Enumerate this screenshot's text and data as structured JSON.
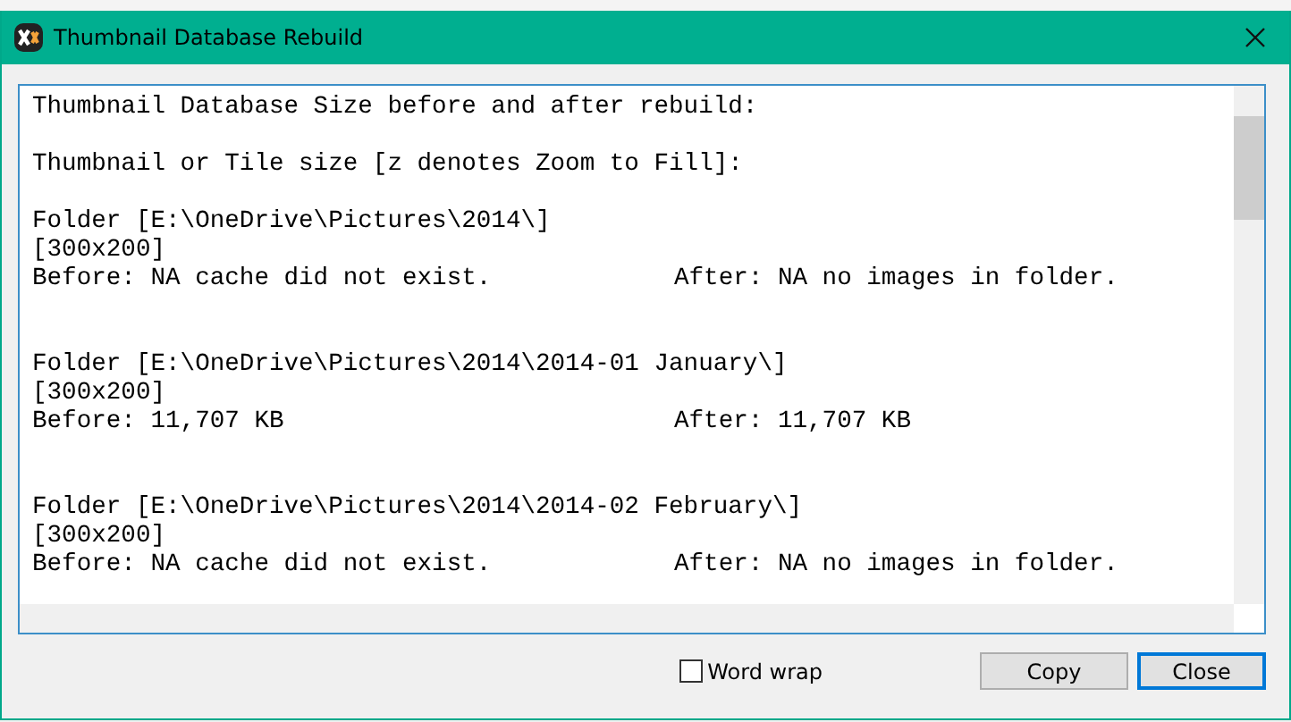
{
  "window": {
    "title": "Thumbnail Database Rebuild"
  },
  "log": {
    "lines": [
      {
        "kind": "text",
        "text": "Thumbnail Database Size before and after rebuild:"
      },
      {
        "kind": "blank"
      },
      {
        "kind": "text",
        "text": "Thumbnail or Tile size [z denotes Zoom to Fill]:"
      },
      {
        "kind": "blank"
      },
      {
        "kind": "text",
        "text": "Folder [E:\\OneDrive\\Pictures\\2014\\]"
      },
      {
        "kind": "text",
        "text": "[300x200]"
      },
      {
        "kind": "pair",
        "before": "Before: NA cache did not exist.",
        "after": "After: NA no images in folder."
      },
      {
        "kind": "blank"
      },
      {
        "kind": "blank"
      },
      {
        "kind": "text",
        "text": "Folder [E:\\OneDrive\\Pictures\\2014\\2014-01 January\\]"
      },
      {
        "kind": "text",
        "text": "[300x200]"
      },
      {
        "kind": "pair",
        "before": "Before: 11,707 KB",
        "after": "After: 11,707 KB"
      },
      {
        "kind": "blank"
      },
      {
        "kind": "blank"
      },
      {
        "kind": "text",
        "text": "Folder [E:\\OneDrive\\Pictures\\2014\\2014-02 February\\]"
      },
      {
        "kind": "text",
        "text": "[300x200]"
      },
      {
        "kind": "pair",
        "before": "Before: NA cache did not exist.",
        "after": "After: NA no images in folder."
      }
    ]
  },
  "word_wrap": {
    "label": "Word wrap",
    "checked": false
  },
  "buttons": [
    {
      "label": "Copy",
      "default": false
    },
    {
      "label": "Close",
      "default": true
    }
  ]
}
